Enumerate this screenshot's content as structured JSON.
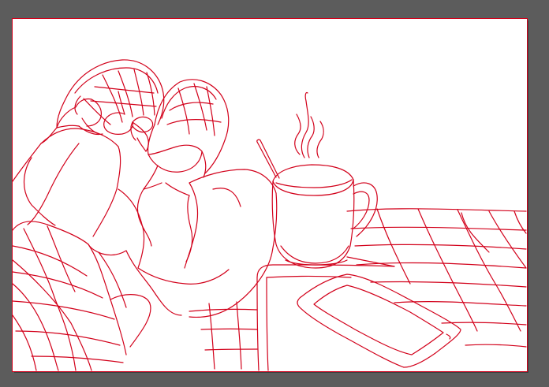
{
  "canvas": {
    "pasteboard_color": "#5c5c5c",
    "artboard_color": "#ffffff",
    "stroke_color": "#d2001a"
  },
  "artwork": {
    "subject": "line-art",
    "icons": [
      "slippers-lineart",
      "steaming-mug-lineart",
      "tablet-lineart",
      "phone-lineart",
      "blanket-grid-lineart"
    ]
  }
}
